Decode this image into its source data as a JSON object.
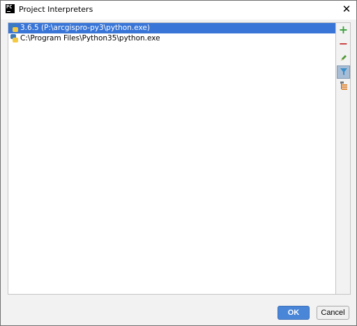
{
  "window": {
    "title": "Project Interpreters",
    "app_icon_text": "PC",
    "close_glyph": "✕"
  },
  "interpreters": [
    {
      "label": "3.6.5 (P:\\arcgispro-py3\\python.exe)",
      "selected": true
    },
    {
      "label": "C:\\Program Files\\Python35\\python.exe",
      "selected": false
    }
  ],
  "toolbar": {
    "add_glyph": "+",
    "remove_glyph": "−",
    "edit_icon": "pencil-icon",
    "filter_icon": "filter-icon",
    "paths_icon": "tree-paths-icon"
  },
  "footer": {
    "ok_label": "OK",
    "cancel_label": "Cancel"
  },
  "colors": {
    "selection": "#3875d7",
    "ok_button": "#4a86d8",
    "add": "#3aa03a",
    "remove": "#c83838"
  }
}
